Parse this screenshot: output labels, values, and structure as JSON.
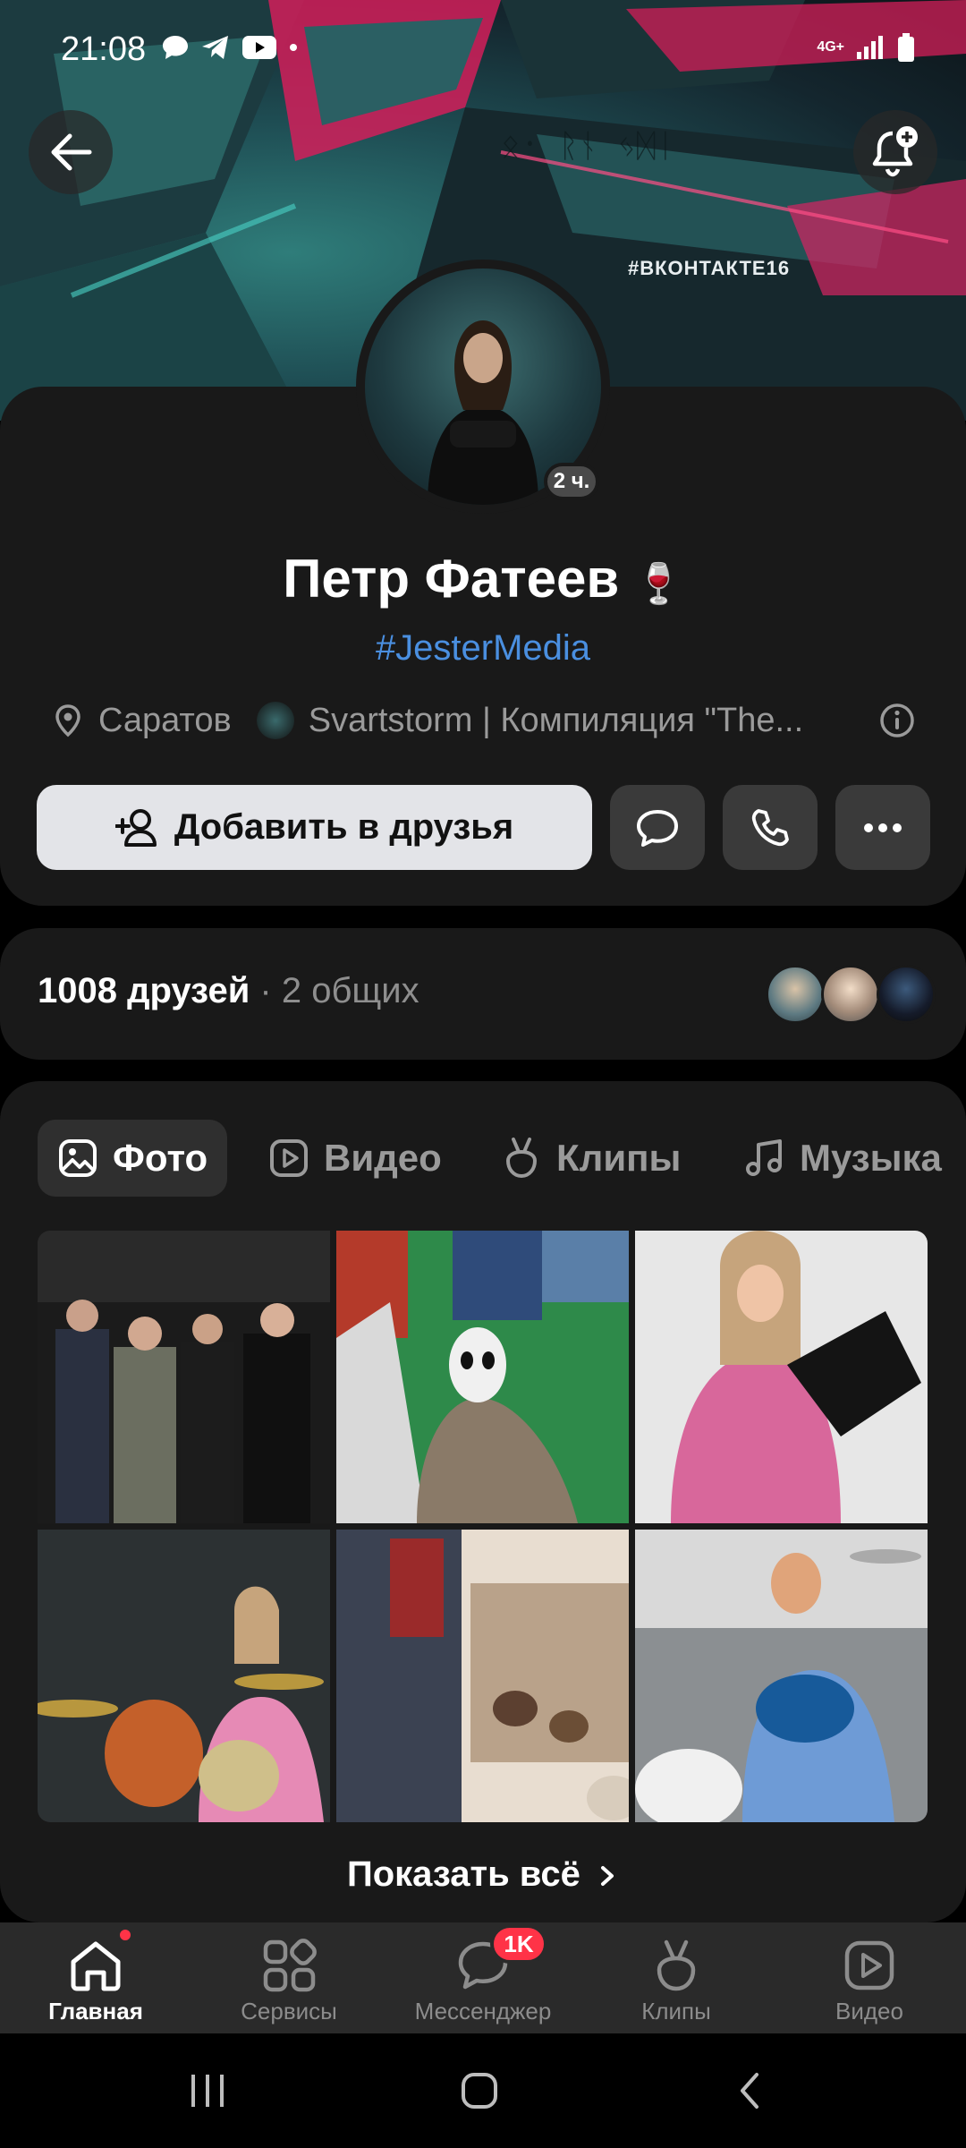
{
  "status_bar": {
    "time": "21:08",
    "network": "4G+"
  },
  "cover": {
    "hashtag": "#ВКОНТАКТЕ16"
  },
  "profile": {
    "name": "Петр Фатеев",
    "name_emoji": "🍷",
    "online_ago": "2 ч.",
    "status": "#JesterMedia",
    "city": "Саратов",
    "music": "Svartstorm | Компиляция \"The..."
  },
  "actions": {
    "add_friend_label": "Добавить в друзья"
  },
  "friends": {
    "count_label": "1008 друзей",
    "mutual_label": " · 2 общих"
  },
  "media_tabs": [
    {
      "label": "Фото",
      "icon": "photo-icon",
      "active": true
    },
    {
      "label": "Видео",
      "icon": "video-icon",
      "active": false
    },
    {
      "label": "Клипы",
      "icon": "clips-icon",
      "active": false
    },
    {
      "label": "Музыка",
      "icon": "music-icon",
      "active": false
    }
  ],
  "show_all_label": "Показать всё",
  "bottom_nav": [
    {
      "label": "Главная",
      "icon": "home-icon",
      "active": true
    },
    {
      "label": "Сервисы",
      "icon": "services-icon",
      "active": false
    },
    {
      "label": "Мессенджер",
      "icon": "messenger-icon",
      "active": false,
      "badge": "1K"
    },
    {
      "label": "Клипы",
      "icon": "clips-icon",
      "active": false
    },
    {
      "label": "Видео",
      "icon": "video-icon",
      "active": false
    }
  ],
  "colors": {
    "accent_link": "#4a8fe0",
    "badge_red": "#ff3347",
    "card_bg": "#191919"
  }
}
